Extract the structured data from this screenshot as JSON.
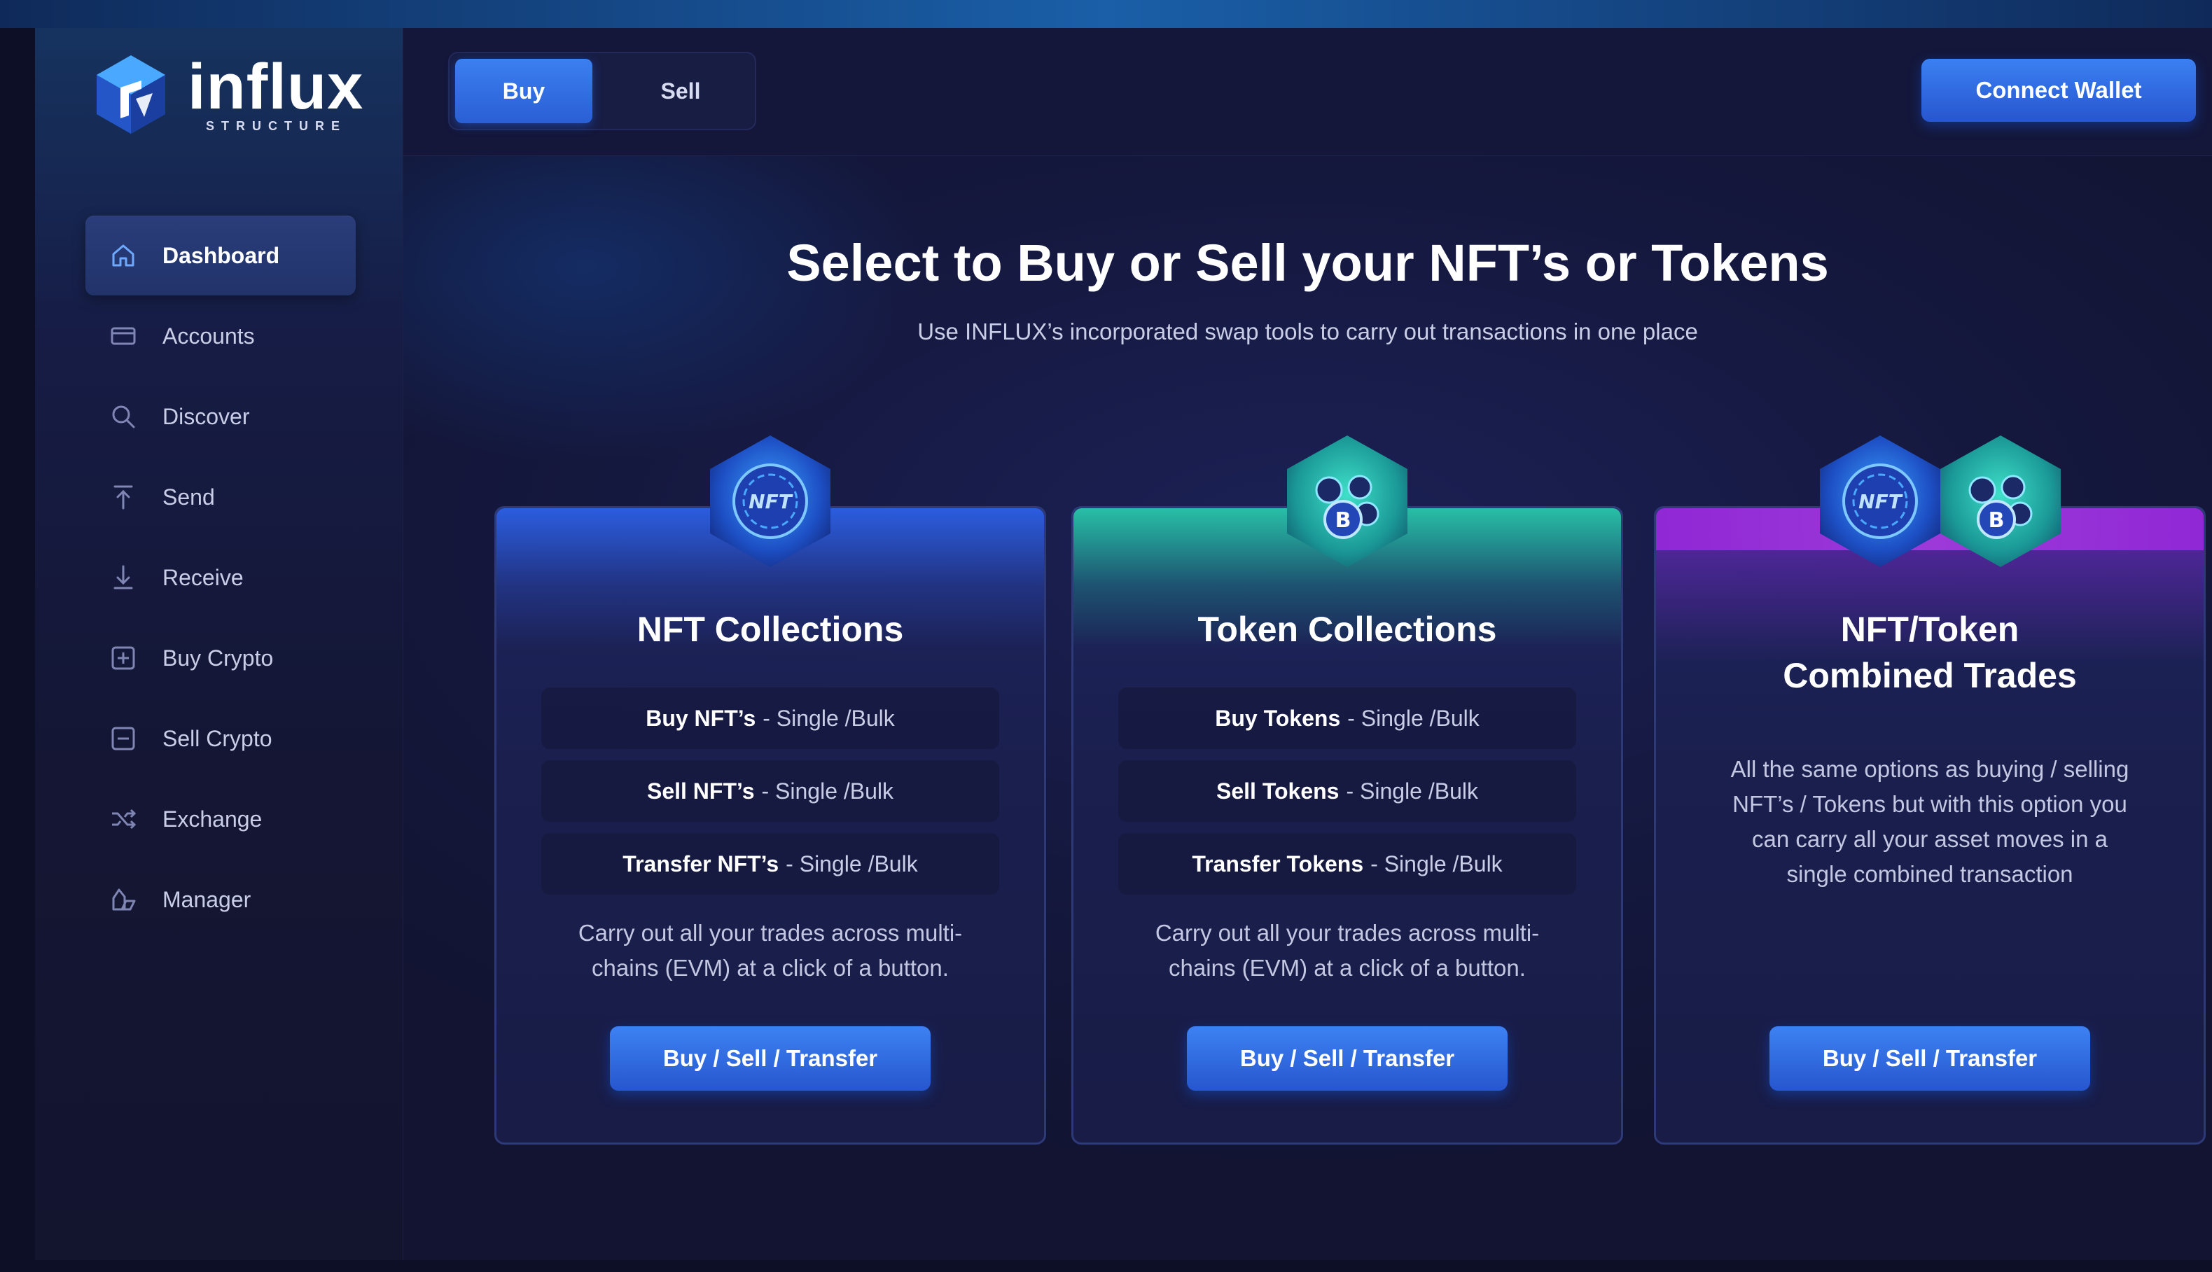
{
  "app": {
    "logo_name": "influx",
    "logo_sub": "STRUCTURE"
  },
  "sidebar": {
    "items": [
      {
        "label": "Dashboard",
        "icon": "home-icon",
        "active": true
      },
      {
        "label": "Accounts",
        "icon": "card-icon"
      },
      {
        "label": "Discover",
        "icon": "search-icon"
      },
      {
        "label": "Send",
        "icon": "arrow-up-icon"
      },
      {
        "label": "Receive",
        "icon": "arrow-down-icon"
      },
      {
        "label": "Buy Crypto",
        "icon": "plus-square-icon"
      },
      {
        "label": "Sell Crypto",
        "icon": "minus-square-icon"
      },
      {
        "label": "Exchange",
        "icon": "shuffle-icon"
      },
      {
        "label": "Manager",
        "icon": "manager-icon"
      }
    ]
  },
  "topbar": {
    "toggle": {
      "buy_label": "Buy",
      "sell_label": "Sell",
      "selected": "Buy"
    },
    "connect_label": "Connect Wallet"
  },
  "main": {
    "title": "Select to Buy or Sell your NFT’s or Tokens",
    "subtitle": "Use INFLUX’s incorporated swap tools to carry out transactions in one place"
  },
  "cards": [
    {
      "title": "NFT Collections",
      "options": [
        {
          "strong": "Buy NFT’s",
          "rest": "- Single /Bulk"
        },
        {
          "strong": "Sell NFT’s",
          "rest": "- Single /Bulk"
        },
        {
          "strong": "Transfer NFT’s",
          "rest": "- Single /Bulk"
        }
      ],
      "desc_line1": "Carry out all your trades across multi-",
      "desc_line2": "chains (EVM) at a click of a button.",
      "button": "Buy / Sell / Transfer"
    },
    {
      "title": "Token Collections",
      "options": [
        {
          "strong": "Buy Tokens",
          "rest": "- Single /Bulk"
        },
        {
          "strong": "Sell Tokens",
          "rest": "- Single /Bulk"
        },
        {
          "strong": "Transfer Tokens",
          "rest": "- Single /Bulk"
        }
      ],
      "desc_line1": "Carry out all your trades across multi-",
      "desc_line2": "chains (EVM) at a click of a button.",
      "button": "Buy / Sell / Transfer"
    },
    {
      "title_line1": "NFT/Token",
      "title_line2": "Combined Trades",
      "desc_line1": "All the same options as buying / selling",
      "desc_line2": "NFT’s / Tokens but with this option you",
      "desc_line3": "can carry all your asset moves in a",
      "desc_line4": "single combined transaction",
      "button": "Buy / Sell / Transfer"
    }
  ],
  "badges": {
    "nft_text": "NFT",
    "coin_text": "B"
  },
  "colors": {
    "accent_blue": "#2f6ee6",
    "token_teal": "#28c8aa",
    "combo_purple": "#9a2ee0",
    "background": "#141634"
  }
}
